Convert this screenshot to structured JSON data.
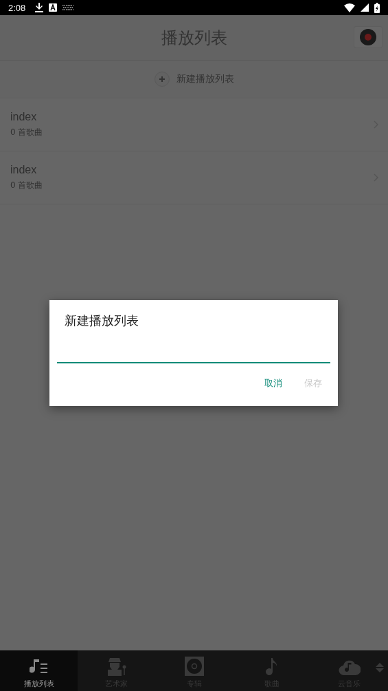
{
  "status_bar": {
    "time": "2:08"
  },
  "app_bar": {
    "title": "播放列表"
  },
  "new_playlist": {
    "label": "新建播放列表"
  },
  "playlists": [
    {
      "name": "index",
      "count": "0 首歌曲"
    },
    {
      "name": "index",
      "count": "0 首歌曲"
    }
  ],
  "dialog": {
    "title": "新建播放列表",
    "buttons": [
      {
        "label": "取消",
        "disabled": false
      },
      {
        "label": "保存",
        "disabled": true
      }
    ]
  },
  "tabs": [
    {
      "label": "播放列表",
      "kind": "playlist",
      "selected": true
    },
    {
      "label": "艺术家",
      "kind": "artist",
      "selected": false
    },
    {
      "label": "专辑",
      "kind": "album",
      "selected": false
    },
    {
      "label": "歌曲",
      "kind": "song",
      "selected": false
    },
    {
      "label": "云音乐",
      "kind": "cloud",
      "selected": false
    }
  ]
}
